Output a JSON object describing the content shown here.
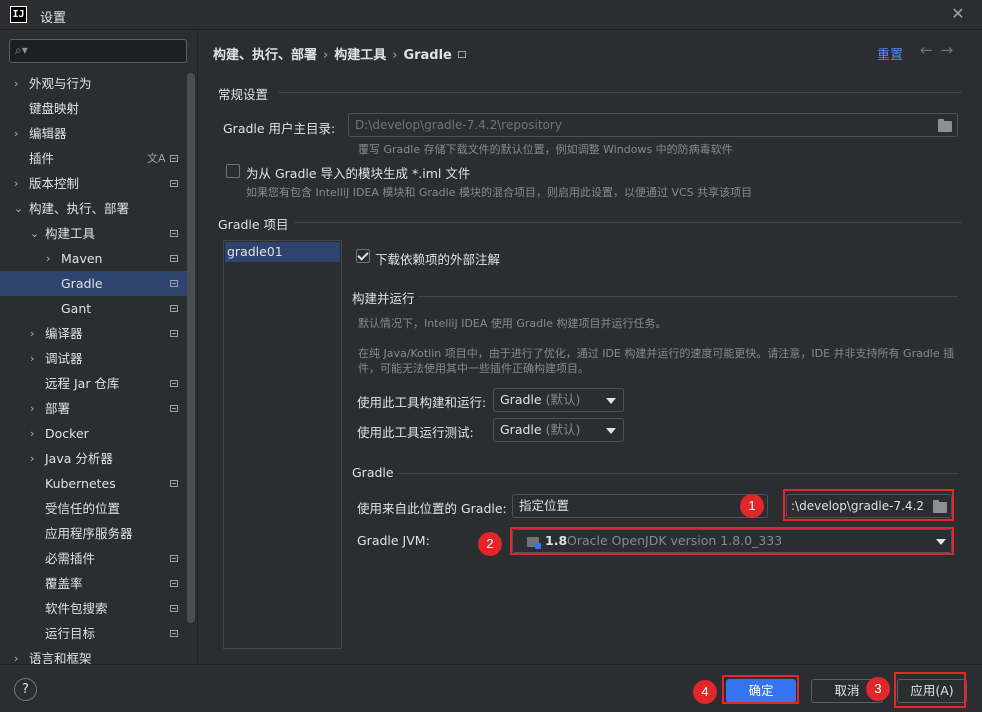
{
  "window": {
    "title": "设置",
    "logo": "IJ"
  },
  "search": {
    "placeholder": ""
  },
  "sidebar": {
    "items": [
      {
        "label": "外观与行为",
        "arrow": "›"
      },
      {
        "label": "键盘映射"
      },
      {
        "label": "编辑器",
        "arrow": "›"
      },
      {
        "label": "插件"
      },
      {
        "label": "版本控制",
        "arrow": "›"
      },
      {
        "label": "构建、执行、部署",
        "arrow": "⌄"
      },
      {
        "label": "构建工具",
        "arrow": "⌄"
      },
      {
        "label": "Maven",
        "arrow": "›"
      },
      {
        "label": "Gradle"
      },
      {
        "label": "Gant"
      },
      {
        "label": "编译器",
        "arrow": "›"
      },
      {
        "label": "调试器",
        "arrow": "›"
      },
      {
        "label": "远程 Jar 仓库"
      },
      {
        "label": "部署",
        "arrow": "›"
      },
      {
        "label": "Docker",
        "arrow": "›"
      },
      {
        "label": "Java 分析器",
        "arrow": "›"
      },
      {
        "label": "Kubernetes"
      },
      {
        "label": "受信任的位置"
      },
      {
        "label": "应用程序服务器"
      },
      {
        "label": "必需插件"
      },
      {
        "label": "覆盖率"
      },
      {
        "label": "软件包搜索"
      },
      {
        "label": "运行目标"
      },
      {
        "label": "语言和框架",
        "arrow": "›"
      }
    ]
  },
  "breadcrumb": {
    "part1": "构建、执行、部署",
    "part2": "构建工具",
    "part3": "Gradle",
    "sep": "›"
  },
  "header": {
    "reset": "重置",
    "back": "←",
    "forward": "→"
  },
  "general": {
    "section": "常规设置",
    "user_home_label": "Gradle 用户主目录:",
    "user_home_value": "D:\\develop\\gradle-7.4.2\\repository",
    "user_home_hint": "覆写 Gradle 存储下载文件的默认位置，例如调整 Windows 中的防病毒软件",
    "iml_label": "为从 Gradle 导入的模块生成 *.iml 文件",
    "iml_hint": "如果您有包含 IntelliJ IDEA 模块和 Gradle 模块的混合项目，则启用此设置，以便通过 VCS 共享该项目"
  },
  "project": {
    "section": "Gradle 项目",
    "items": [
      "gradle01"
    ],
    "download_annotations": "下载依赖项的外部注解",
    "build_run_section": "构建并运行",
    "build_run_hint1": "默认情况下，IntelliJ IDEA 使用 Gradle 构建项目并运行任务。",
    "build_run_hint2": "在纯 Java/Kotlin 项目中，由于进行了优化，通过 IDE 构建并运行的速度可能更快。请注意，IDE 并非支持所有 Gradle 插",
    "build_run_hint3": "件，可能无法使用其中一些插件正确构建项目。",
    "build_run_label": "使用此工具构建和运行:",
    "build_run_value": "Gradle",
    "build_run_default": "(默认)",
    "test_label": "使用此工具运行测试:",
    "test_value": "Gradle",
    "test_default": "(默认)",
    "gradle_section": "Gradle",
    "use_gradle_from_label": "使用来自此位置的 Gradle:",
    "use_gradle_from_value": "指定位置",
    "gradle_path": ":\\develop\\gradle-7.4.2",
    "jvm_label": "Gradle JVM:",
    "jvm_version": "1.8",
    "jvm_name": "Oracle OpenJDK version 1.8.0_333"
  },
  "annotations": {
    "b1": "1",
    "b2": "2",
    "b3": "3",
    "b4": "4"
  },
  "footer": {
    "help": "?",
    "ok": "确定",
    "cancel": "取消",
    "apply": "应用(A)"
  },
  "colors": {
    "accent": "#3574f0",
    "annotation_red": "#e0282b",
    "selection": "#2e436e"
  },
  "icons": {
    "search": "search-icon",
    "folder": "folder-icon",
    "settings_mark": "settings-mark-icon",
    "translate": "translate-icon"
  }
}
